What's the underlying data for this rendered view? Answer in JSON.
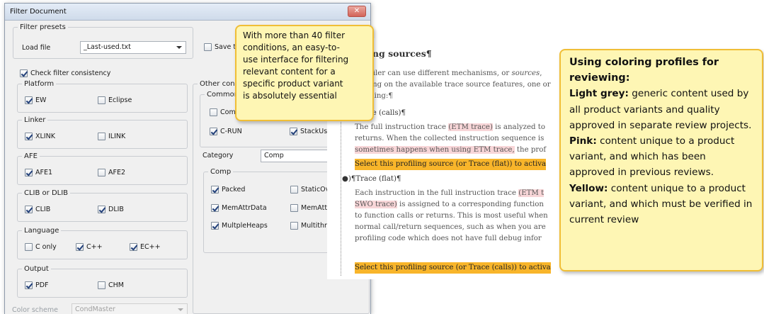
{
  "dialog": {
    "title": "Filter Document",
    "close_label": "✕",
    "filter_presets": {
      "legend": "Filter presets",
      "load_file_label": "Load file",
      "load_file_value": "_Last-used.txt",
      "save_label": "Save to"
    },
    "check_consistency": {
      "label": "Check filter consistency",
      "checked": true
    },
    "platform": {
      "legend": "Platform",
      "items": [
        {
          "label": "EW",
          "checked": true
        },
        {
          "label": "Eclipse",
          "checked": false
        }
      ]
    },
    "linker": {
      "legend": "Linker",
      "items": [
        {
          "label": "XLINK",
          "checked": true
        },
        {
          "label": "ILINK",
          "checked": false
        }
      ]
    },
    "afe": {
      "legend": "AFE",
      "items": [
        {
          "label": "AFE1",
          "checked": true
        },
        {
          "label": "AFE2",
          "checked": false
        }
      ]
    },
    "clib": {
      "legend": "CLIB or DLIB",
      "items": [
        {
          "label": "CLIB",
          "checked": true
        },
        {
          "label": "DLIB",
          "checked": true
        }
      ]
    },
    "language": {
      "legend": "Language",
      "items": [
        {
          "label": "C only",
          "checked": false
        },
        {
          "label": "C++",
          "checked": true
        },
        {
          "label": "EC++",
          "checked": true
        }
      ]
    },
    "output": {
      "legend": "Output",
      "items": [
        {
          "label": "PDF",
          "checked": true
        },
        {
          "label": "CHM",
          "checked": false
        }
      ]
    },
    "color_scheme": {
      "label": "Color scheme",
      "value": "CondMaster"
    },
    "other": {
      "legend": "Other cond",
      "common": {
        "legend": "Common",
        "items": [
          {
            "label": "Comm",
            "checked": false
          },
          {
            "label": "C-RUN",
            "checked": true
          },
          {
            "label": "StackUsa",
            "checked": true
          }
        ]
      }
    },
    "category": {
      "label": "Category",
      "value": "Comp",
      "comp": {
        "legend": "Comp",
        "items": [
          {
            "label": "Packed",
            "checked": true
          },
          {
            "label": "StaticOv",
            "checked": false
          },
          {
            "label": "MemAttrData",
            "checked": true
          },
          {
            "label": "MemAttr",
            "checked": false
          },
          {
            "label": "MultpleHeaps",
            "checked": true
          },
          {
            "label": "Multithre",
            "checked": false
          }
        ]
      }
    }
  },
  "callout1": {
    "lines": [
      "With more than 40 filter",
      "conditions, an easy-to-",
      "use interface for filtering",
      "relevant content for a",
      "specific product variant",
      "is absolutely essential"
    ]
  },
  "document": {
    "heading": "Profiling sources¶",
    "p1_l1": "The profiler can use different mechanisms, or ",
    "p1_l1_em": "sources",
    "p1_l1_end": ",",
    "p1_l2": "Depending on the available trace source features, one or",
    "p1_l3": "for profiling:¶",
    "b1": "●)¶Trace (calls)¶",
    "b1_l1a": "The full instruction trace ",
    "b1_l1_pink": "(ETM trace)",
    "b1_l1b": " is analyzed to",
    "b1_l2": "returns. When the collected instruction sequence is",
    "b1_l3_pink": "sometimes happens when using ETM trace,",
    "b1_l3b": " the prof",
    "b1_hl": "Select this profiling source (or Trace (flat)) to activa",
    "b2": "●)¶Trace (flat)¶",
    "b2_l1a": "Each instruction in the full instruction trace ",
    "b2_l1_pink": "(ETM t",
    "b2_l2_pink": "SWO trace)",
    "b2_l2b": " is assigned to a corresponding function",
    "b2_l3": "to function calls or returns. This is most useful when",
    "b2_l4": "normal call/return sequences, such as when you are",
    "b2_l5": "profiling code which does not have full debug infor",
    "b2_hl": "Select this profiling source (or Trace (calls)) to activa"
  },
  "callout2": {
    "title": "Using coloring profiles for reviewing:",
    "grey_key": "Light grey:",
    "grey_text": "generic content used by all product variants and quality approved in separate review projects.",
    "pink_key": "Pink:",
    "pink_text": "content unique to a product variant, and which has been approved in previous reviews.",
    "yellow_key": "Yellow:",
    "yellow_text": "content unique to a product variant, and which must be verified in current review"
  },
  "colors": {
    "callout_bg": "#fef6b4",
    "callout_border": "#f0be36",
    "pink": "#f8d6d8",
    "yellow": "#f8b52a"
  }
}
